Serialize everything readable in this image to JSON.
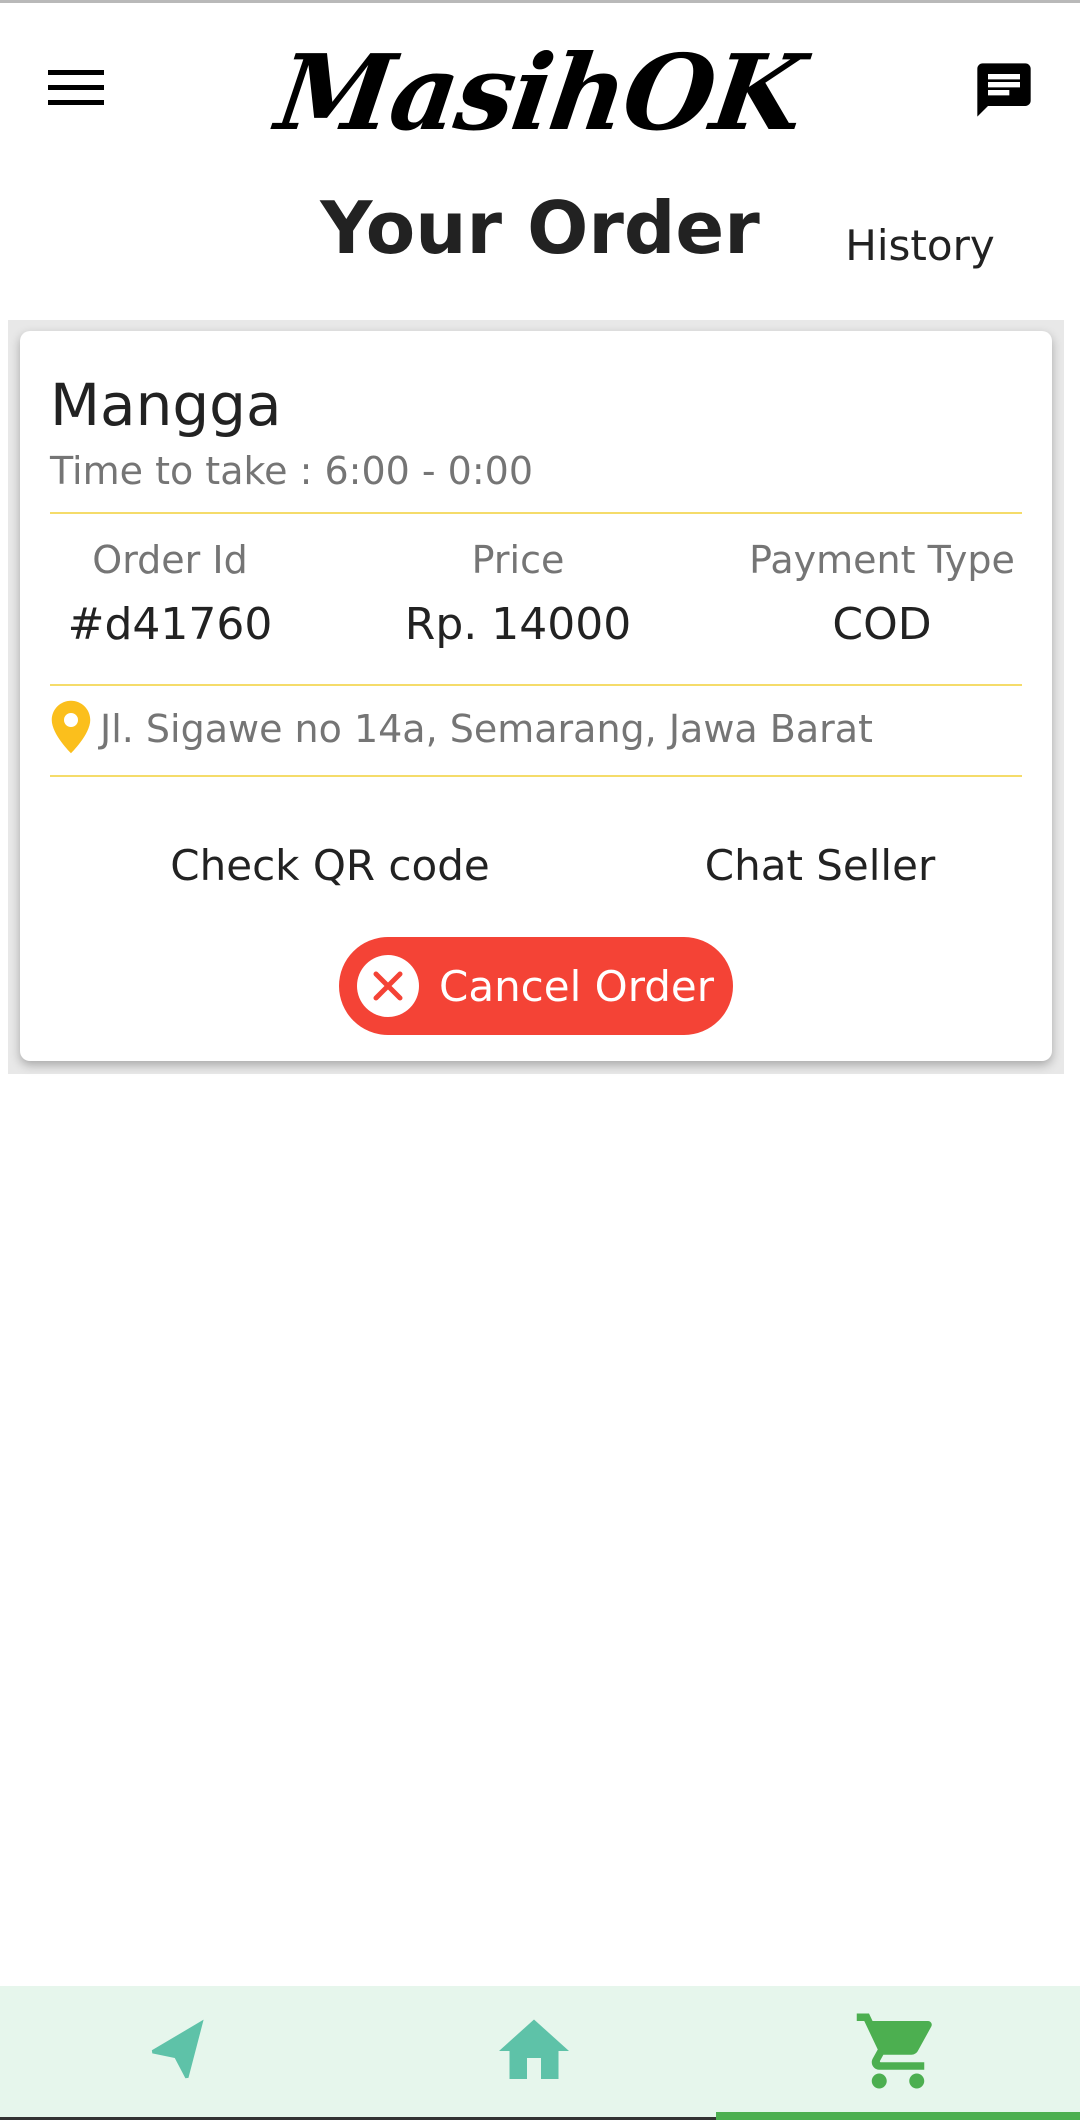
{
  "app": {
    "logo_text": "MasihOK",
    "menu_icon": "menu-icon",
    "chat_icon": "chat-message-icon"
  },
  "header": {
    "title": "Your Order",
    "history_label": "History"
  },
  "order": {
    "product_name": "Mangga",
    "time_to_take": "Time to take : 6:00 - 0:00",
    "order_id_label": "Order Id",
    "order_id_value": "#d41760",
    "price_label": "Price",
    "price_value": "Rp. 14000",
    "payment_label": "Payment Type",
    "payment_value": "COD",
    "address": "Jl. Sigawe no 14a, Semarang, Jawa Barat",
    "check_qr_label": "Check QR code",
    "chat_seller_label": "Chat Seller",
    "cancel_label": "Cancel Order"
  },
  "bottom_nav": {
    "items": [
      {
        "icon": "navigation-arrow-icon",
        "active": false
      },
      {
        "icon": "home-icon",
        "active": false
      },
      {
        "icon": "shopping-cart-icon",
        "active": true
      }
    ]
  },
  "colors": {
    "accent_teal": "#5ec2a8",
    "active_green": "#4caf50",
    "cancel_red": "#f44336",
    "divider_yellow": "#f5dc6a",
    "location_pin_yellow": "#fbbf1c",
    "nav_background": "#e6f6ec"
  }
}
